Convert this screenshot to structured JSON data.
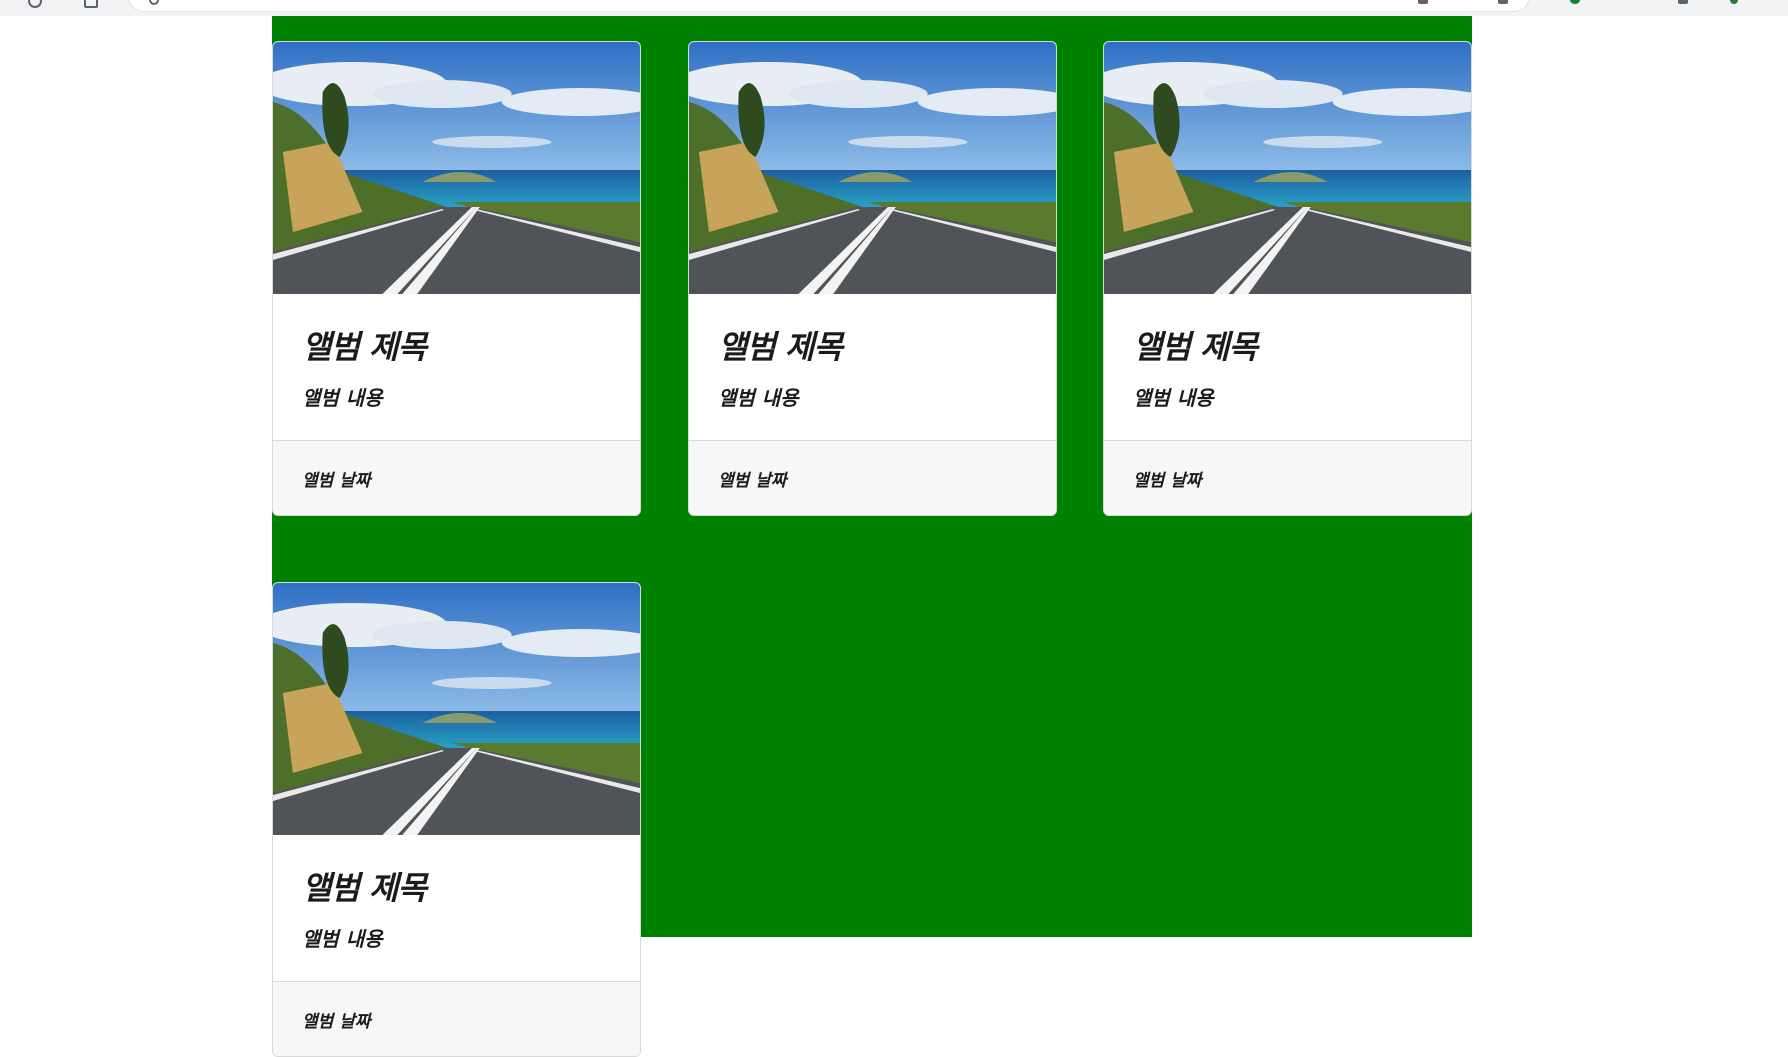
{
  "colors": {
    "container_bg": "#008000",
    "card_bg": "#ffffff",
    "footer_bg": "#f7f7f7",
    "text": "#1b1b1b"
  },
  "cards": [
    {
      "title": "앨범 제목",
      "text": "앨범 내용",
      "date": "앨범 날짜"
    },
    {
      "title": "앨범 제목",
      "text": "앨범 내용",
      "date": "앨범 날짜"
    },
    {
      "title": "앨범 제목",
      "text": "앨범 내용",
      "date": "앨범 날짜"
    },
    {
      "title": "앨범 제목",
      "text": "앨범 내용",
      "date": "앨범 날짜"
    }
  ],
  "icons": [
    "reload-icon",
    "apps-icon",
    "lock-icon",
    "extensions-icon",
    "profile-icon"
  ]
}
